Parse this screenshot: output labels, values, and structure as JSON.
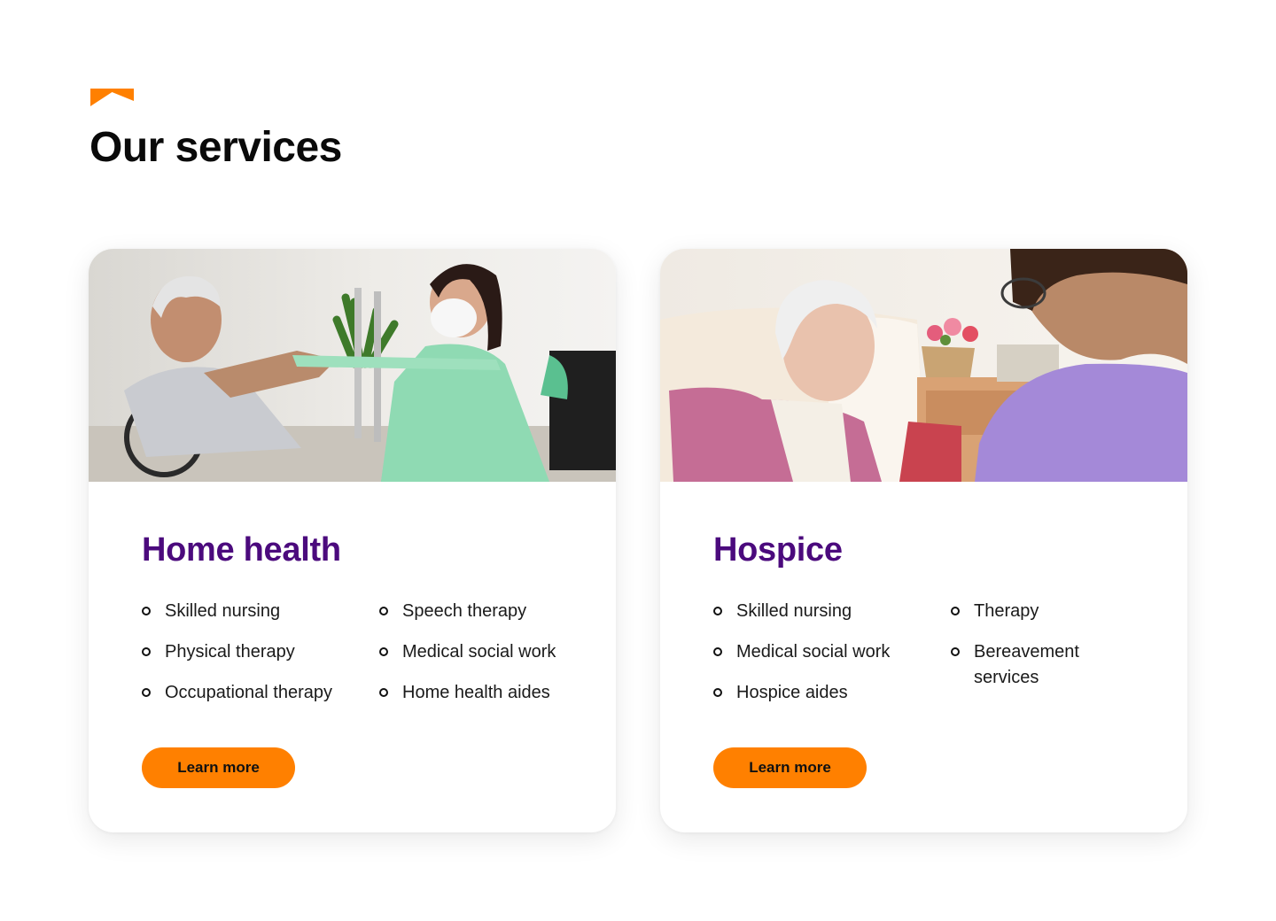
{
  "section": {
    "title": "Our services",
    "accent_color": "#FF8000",
    "icon": "brand-chevron-icon"
  },
  "cards": [
    {
      "title": "Home health",
      "image": "photo: caregiver in mask and scrubs helping elderly man in wheelchair with resistance band exercise",
      "columns": [
        [
          "Skilled nursing",
          "Physical therapy",
          "Occupational therapy"
        ],
        [
          "Speech therapy",
          "Medical social work",
          "Home health aides"
        ]
      ],
      "button_label": "Learn more"
    },
    {
      "title": "Hospice",
      "image": "photo: smiling elderly woman in pink cardigan talking with nurse in lavender scrubs",
      "columns": [
        [
          "Skilled nursing",
          "Medical social work",
          "Hospice aides"
        ],
        [
          "Therapy",
          "Bereavement services"
        ]
      ],
      "button_label": "Learn more"
    }
  ],
  "colors": {
    "title_purple": "#4B0A7D",
    "button_orange": "#FF8000",
    "text": "#111111"
  }
}
